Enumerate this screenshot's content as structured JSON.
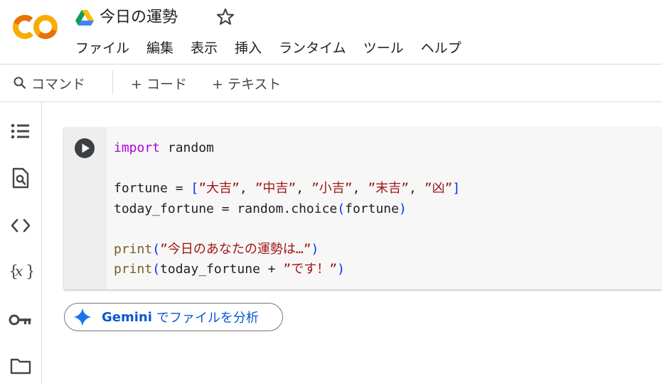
{
  "app": {
    "logo_name": "colab-logo",
    "title": "今日の運勢"
  },
  "menu": [
    "ファイル",
    "編集",
    "表示",
    "挿入",
    "ランタイム",
    "ツール",
    "ヘルプ"
  ],
  "toolbar": {
    "command_label": "コマンド",
    "add_code_label": "+ コード",
    "add_text_label": "+ テキスト"
  },
  "rail_icons": [
    "toc-icon",
    "find-replace-icon",
    "code-snippets-icon",
    "variables-icon",
    "secrets-key-icon",
    "files-folder-icon"
  ],
  "cell": {
    "lines": [
      "import random",
      "",
      "fortune = [\"大吉\", \"中吉\", \"小吉\", \"末吉\", \"凶\"]",
      "today_fortune = random.choice(fortune)",
      "",
      "print(\"今日のあなたの運勢は…\")",
      "print(today_fortune + \"です！\")"
    ]
  },
  "gemini": {
    "brand": "Gemini",
    "label": "でファイルを分析"
  },
  "colors": {
    "keyword": "#af00db",
    "function": "#795e26",
    "string": "#a31515",
    "bracket": "#0431fa",
    "gemini_blue": "#0b57d0",
    "logo_orange": "#f9ab00",
    "logo_dark_orange": "#e8710a"
  }
}
